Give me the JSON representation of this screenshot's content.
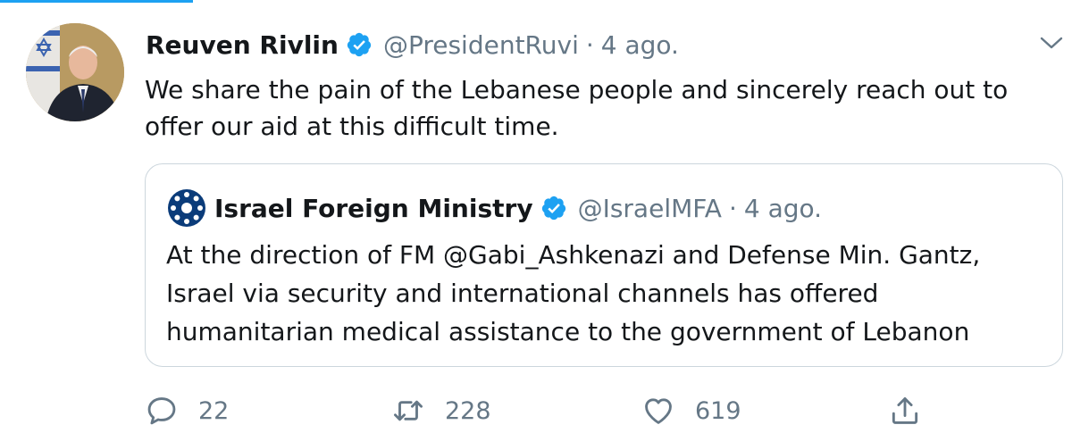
{
  "tweet": {
    "author_name": "Reuven Rivlin",
    "handle": "@PresidentRuvi",
    "separator": "·",
    "time": "4 ago.",
    "text": "We share the pain of the Lebanese people and sincerely reach out to offer our aid at this difficult time."
  },
  "quoted_tweet": {
    "author_name": "Israel Foreign Ministry",
    "handle": "@IsraelMFA",
    "separator": "·",
    "time": "4 ago.",
    "text": "At the direction of FM @Gabi_Ashkenazi and Defense Min. Gantz, Israel via security and international channels has offered humanitarian medical assistance to the government of Lebanon"
  },
  "actions": {
    "reply_count": "22",
    "retweet_count": "228",
    "like_count": "619"
  },
  "colors": {
    "accent": "#1da1f2",
    "secondary_text": "#657786",
    "border": "#ccd6dd"
  },
  "icons": [
    "verified-badge-icon",
    "chevron-down-icon",
    "reply-icon",
    "retweet-icon",
    "like-icon",
    "share-icon"
  ]
}
